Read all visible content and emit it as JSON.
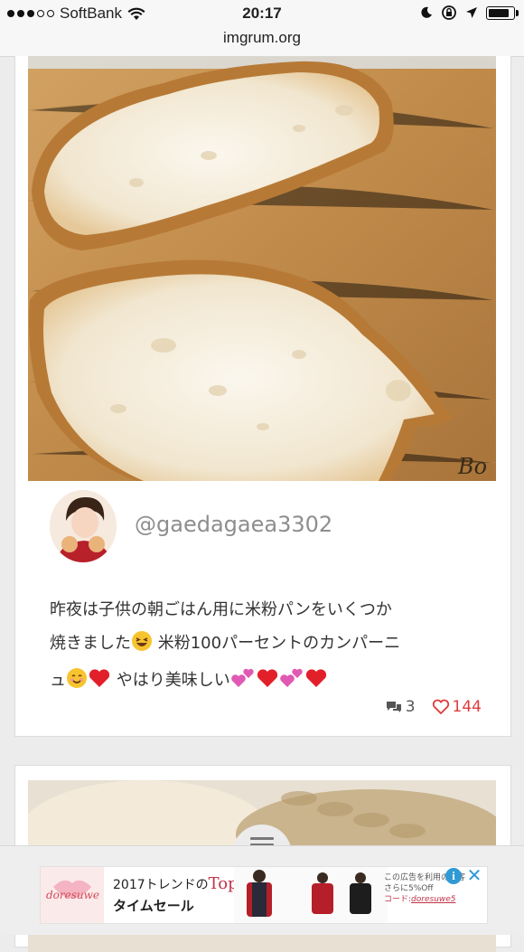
{
  "status_bar": {
    "carrier": "SoftBank",
    "time": "20:17",
    "url": "imgrum.org",
    "battery_level": 0.85
  },
  "post": {
    "username": "@gaedagaea3302",
    "caption_line1": "昨夜は子供の朝ごはん用に米粉パンをいくつか",
    "caption_line2_a": "焼きました",
    "caption_line2_b": " 米粉100パーセントのカンパーニ",
    "caption_line3_a": "ュ",
    "caption_line3_b": " やはり美味しい",
    "comments_count": "3",
    "likes_count": "144",
    "photo_corner_text": "Bo"
  },
  "ad": {
    "logo_text": "doresuwe",
    "headline_prefix": "2017トレンドの",
    "headline_brand": "Tops",
    "subline": "タイムセール",
    "right_line1": "この広告を利用のお客",
    "right_line2": "さらに5%Off",
    "right_code_label": "コード:",
    "right_code": "doresuwe5",
    "info_icon": "i",
    "close_icon": "✕"
  },
  "colors": {
    "like_red": "#e03b3b",
    "info_blue": "#2f9ad3",
    "username_gray": "#8e8e8e"
  },
  "icons": [
    "wifi-icon",
    "moon-icon",
    "rotation-lock-icon",
    "location-arrow-icon",
    "battery-icon",
    "comment-icon",
    "heart-icon",
    "hamburger-menu-icon",
    "ad-info-icon",
    "ad-close-icon"
  ]
}
